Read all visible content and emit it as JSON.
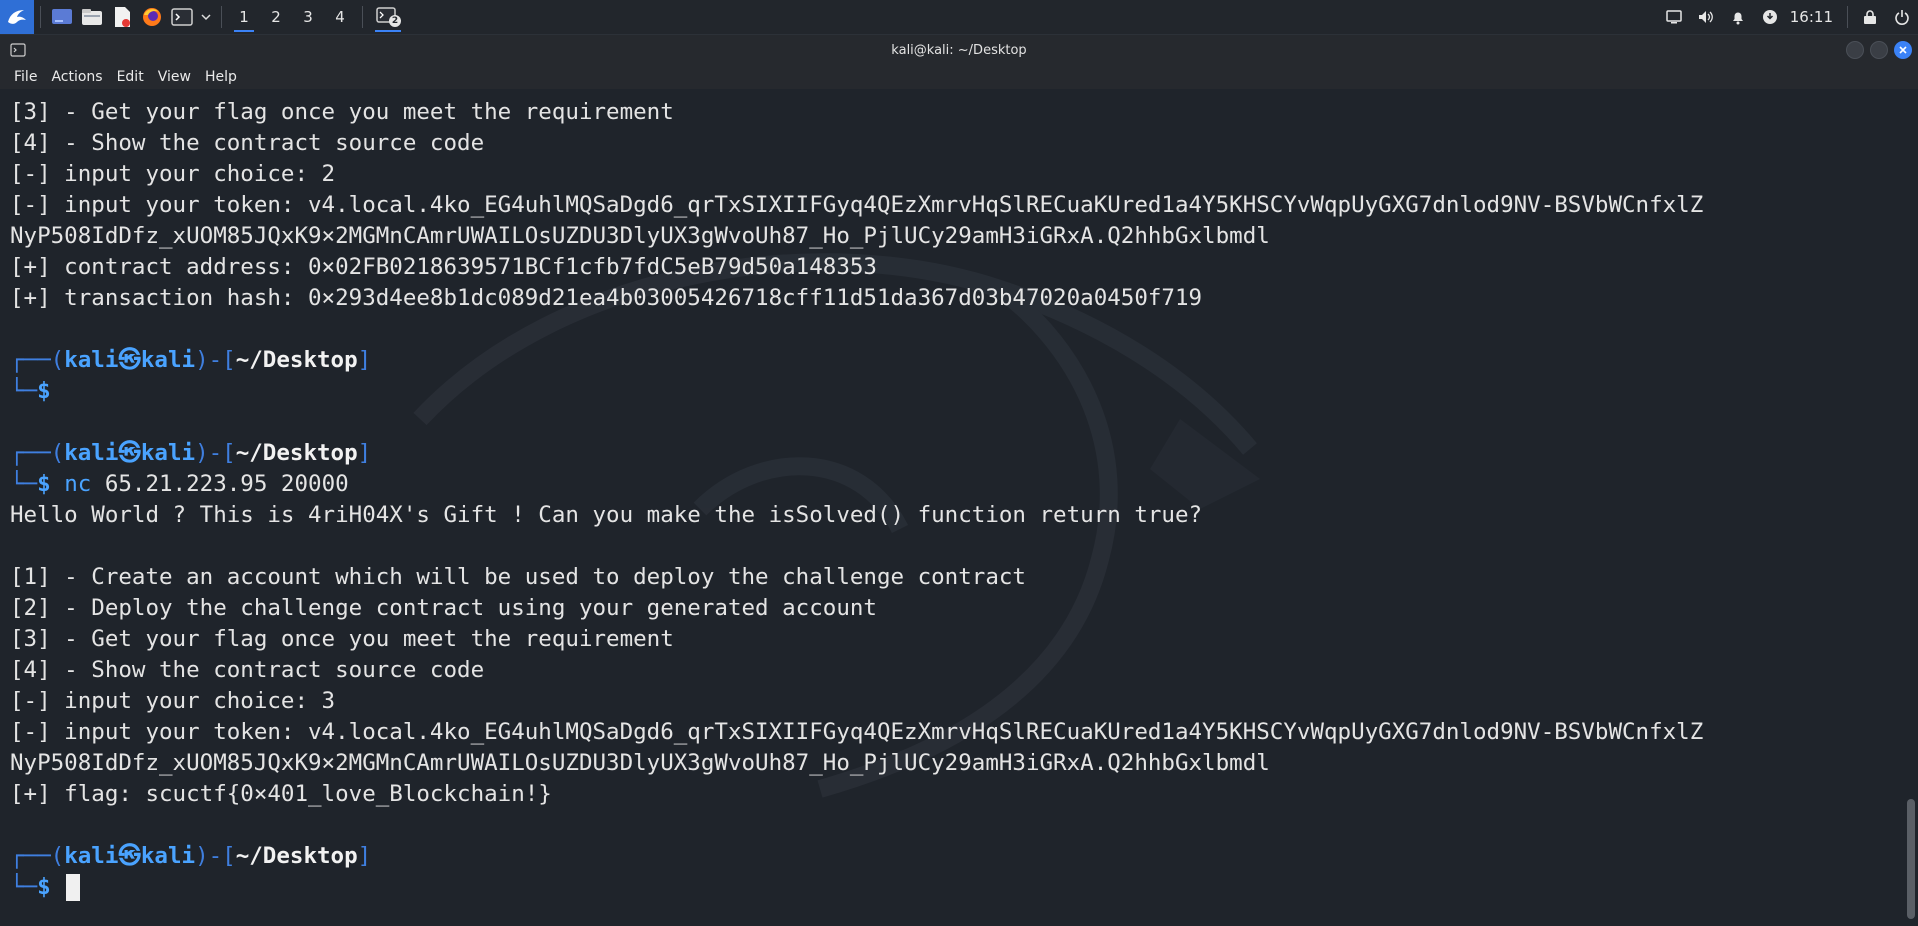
{
  "panel": {
    "workspaces": [
      "1",
      "2",
      "3",
      "4"
    ],
    "active_workspace": "1",
    "task_badge": "2",
    "clock": "16:11",
    "icons": [
      "kali-menu-icon",
      "desktop-icon",
      "file-manager-icon",
      "text-editor-icon",
      "firefox-icon",
      "terminal-icon",
      "chevron-down-icon"
    ],
    "tray_icons": [
      "display-icon",
      "volume-icon",
      "notification-bell-icon",
      "update-icon",
      "lock-icon",
      "power-icon"
    ]
  },
  "window": {
    "title": "kali@kali: ~/Desktop"
  },
  "menubar": {
    "items": [
      "File",
      "Actions",
      "Edit",
      "View",
      "Help"
    ]
  },
  "terminal": {
    "accent": "#4aa3ff",
    "lines": [
      {
        "type": "text",
        "text": "[3] - Get your flag once you meet the requirement"
      },
      {
        "type": "text",
        "text": "[4] - Show the contract source code"
      },
      {
        "type": "text",
        "text": "[-] input your choice: 2"
      },
      {
        "type": "text",
        "text": "[-] input your token: v4.local.4ko_EG4uhlMQSaDgd6_qrTxSIXIIFGyq4QEzXmrvHqSlRECuaKUred1a4Y5KHSCYvWqpUyGXG7dnlod9NV-BSVbWCnfxlZ"
      },
      {
        "type": "text",
        "text": "NyP508IdDfz_xUOM85JQxK9×2MGMnCAmrUWAILOsUZDU3DlyUX3gWvoUh87_Ho_PjlUCy29amH3iGRxA.Q2hhbGxlbmdl"
      },
      {
        "type": "text",
        "text": "[+] contract address: 0×02FB0218639571BCf1cfb7fdC5eB79d50a148353"
      },
      {
        "type": "text",
        "text": "[+] transaction hash: 0×293d4ee8b1dc089d21ea4b03005426718cff11d51da367d03b47020a0450f719"
      },
      {
        "type": "blank",
        "text": ""
      },
      {
        "type": "prompt-top",
        "user": "kali",
        "host": "kali",
        "sym": "㉿",
        "path": "~/Desktop"
      },
      {
        "type": "prompt-bottom",
        "cmd": "",
        "args": ""
      },
      {
        "type": "blank",
        "text": ""
      },
      {
        "type": "prompt-top",
        "user": "kali",
        "host": "kali",
        "sym": "㉿",
        "path": "~/Desktop"
      },
      {
        "type": "prompt-bottom",
        "cmd": "nc",
        "args": " 65.21.223.95 20000"
      },
      {
        "type": "text",
        "text": "Hello World ? This is 4riH04X's Gift ! Can you make the isSolved() function return true?"
      },
      {
        "type": "blank",
        "text": ""
      },
      {
        "type": "text",
        "text": "[1] - Create an account which will be used to deploy the challenge contract"
      },
      {
        "type": "text",
        "text": "[2] - Deploy the challenge contract using your generated account"
      },
      {
        "type": "text",
        "text": "[3] - Get your flag once you meet the requirement"
      },
      {
        "type": "text",
        "text": "[4] - Show the contract source code"
      },
      {
        "type": "text",
        "text": "[-] input your choice: 3"
      },
      {
        "type": "text",
        "text": "[-] input your token: v4.local.4ko_EG4uhlMQSaDgd6_qrTxSIXIIFGyq4QEzXmrvHqSlRECuaKUred1a4Y5KHSCYvWqpUyGXG7dnlod9NV-BSVbWCnfxlZ"
      },
      {
        "type": "text",
        "text": "NyP508IdDfz_xUOM85JQxK9×2MGMnCAmrUWAILOsUZDU3DlyUX3gWvoUh87_Ho_PjlUCy29amH3iGRxA.Q2hhbGxlbmdl"
      },
      {
        "type": "text",
        "text": "[+] flag: scuctf{0×401_love_Blockchain!}"
      },
      {
        "type": "blank",
        "text": ""
      },
      {
        "type": "prompt-top",
        "user": "kali",
        "host": "kali",
        "sym": "㉿",
        "path": "~/Desktop"
      },
      {
        "type": "prompt-bottom",
        "cmd": "",
        "args": "",
        "cursor": true
      }
    ]
  }
}
